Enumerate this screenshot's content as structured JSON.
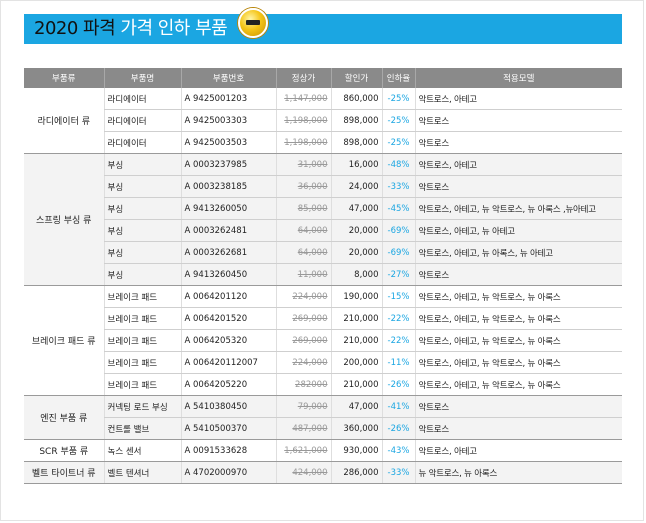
{
  "banner": {
    "title_dark": "2020 파격",
    "title_white": "가격 인하 부품"
  },
  "table": {
    "headers": [
      "부품류",
      "부품명",
      "부품번호",
      "정상가",
      "할인가",
      "인하율",
      "적용모델"
    ],
    "groups": [
      {
        "category": "라디에이터 류",
        "rows": [
          {
            "name": "라디에이터",
            "part_no": "A 9425001203",
            "regular": "1,147,000",
            "sale": "860,000",
            "rate": "-25%",
            "models": "악트로스, 아테고"
          },
          {
            "name": "라디에이터",
            "part_no": "A 9425003303",
            "regular": "1,198,000",
            "sale": "898,000",
            "rate": "-25%",
            "models": "악트로스"
          },
          {
            "name": "라디에이터",
            "part_no": "A 9425003503",
            "regular": "1,198,000",
            "sale": "898,000",
            "rate": "-25%",
            "models": "악트로스"
          }
        ]
      },
      {
        "category": "스프링 부싱 류",
        "rows": [
          {
            "name": "부싱",
            "part_no": "A 0003237985",
            "regular": "31,000",
            "sale": "16,000",
            "rate": "-48%",
            "models": "악트로스, 아테고"
          },
          {
            "name": "부싱",
            "part_no": "A 0003238185",
            "regular": "36,000",
            "sale": "24,000",
            "rate": "-33%",
            "models": "악트로스"
          },
          {
            "name": "부싱",
            "part_no": "A 9413260050",
            "regular": "85,000",
            "sale": "47,000",
            "rate": "-45%",
            "models": "악트로스, 아테고, 뉴 악트로스, 뉴 아록스 ,뉴아테고"
          },
          {
            "name": "부싱",
            "part_no": "A 0003262481",
            "regular": "64,000",
            "sale": "20,000",
            "rate": "-69%",
            "models": "악트로스, 아테고, 뉴 아테고"
          },
          {
            "name": "부싱",
            "part_no": "A 0003262681",
            "regular": "64,000",
            "sale": "20,000",
            "rate": "-69%",
            "models": "악트로스, 아테고, 뉴 아록스, 뉴 아테고"
          },
          {
            "name": "부싱",
            "part_no": "A 9413260450",
            "regular": "11,000",
            "sale": "8,000",
            "rate": "-27%",
            "models": "악트로스"
          }
        ]
      },
      {
        "category": "브레이크 패드 류",
        "rows": [
          {
            "name": "브레이크 패드",
            "part_no": "A 0064201120",
            "regular": "224,000",
            "sale": "190,000",
            "rate": "-15%",
            "models": "악트로스, 아테고, 뉴 악트로스, 뉴 아록스"
          },
          {
            "name": "브레이크 패드",
            "part_no": "A 0064201520",
            "regular": "269,000",
            "sale": "210,000",
            "rate": "-22%",
            "models": "악트로스, 아테고, 뉴 악트로스, 뉴 아록스"
          },
          {
            "name": "브레이크 패드",
            "part_no": "A 0064205320",
            "regular": "269,000",
            "sale": "210,000",
            "rate": "-22%",
            "models": "악트로스, 아테고, 뉴 악트로스, 뉴 아록스"
          },
          {
            "name": "브레이크 패드",
            "part_no": "A 006420112007",
            "regular": "224,000",
            "sale": "200,000",
            "rate": "-11%",
            "models": "악트로스, 아테고, 뉴 악트로스, 뉴 아록스"
          },
          {
            "name": "브레이크 패드",
            "part_no": "A 0064205220",
            "regular": "282000",
            "sale": "210,000",
            "rate": "-26%",
            "models": "악트로스, 아테고, 뉴 악트로스, 뉴 아록스"
          }
        ]
      },
      {
        "category": "엔진 부품 류",
        "rows": [
          {
            "name": "커넥팅 로드 부싱",
            "part_no": "A 5410380450",
            "regular": "79,000",
            "sale": "47,000",
            "rate": "-41%",
            "models": "악트로스"
          },
          {
            "name": "컨트롤 밸브",
            "part_no": "A 5410500370",
            "regular": "487,000",
            "sale": "360,000",
            "rate": "-26%",
            "models": "악트로스"
          }
        ]
      },
      {
        "category": "SCR 부품 류",
        "rows": [
          {
            "name": "녹스 센서",
            "part_no": "A 0091533628",
            "regular": "1,621,000",
            "sale": "930,000",
            "rate": "-43%",
            "models": "악트로스, 아테고"
          }
        ]
      },
      {
        "category": "벨트 타이트너 류",
        "rows": [
          {
            "name": "벨트 텐셔너",
            "part_no": "A 4702000970",
            "regular": "424,000",
            "sale": "286,000",
            "rate": "-33%",
            "models": "뉴 악트로스, 뉴 아록스"
          }
        ]
      }
    ]
  }
}
